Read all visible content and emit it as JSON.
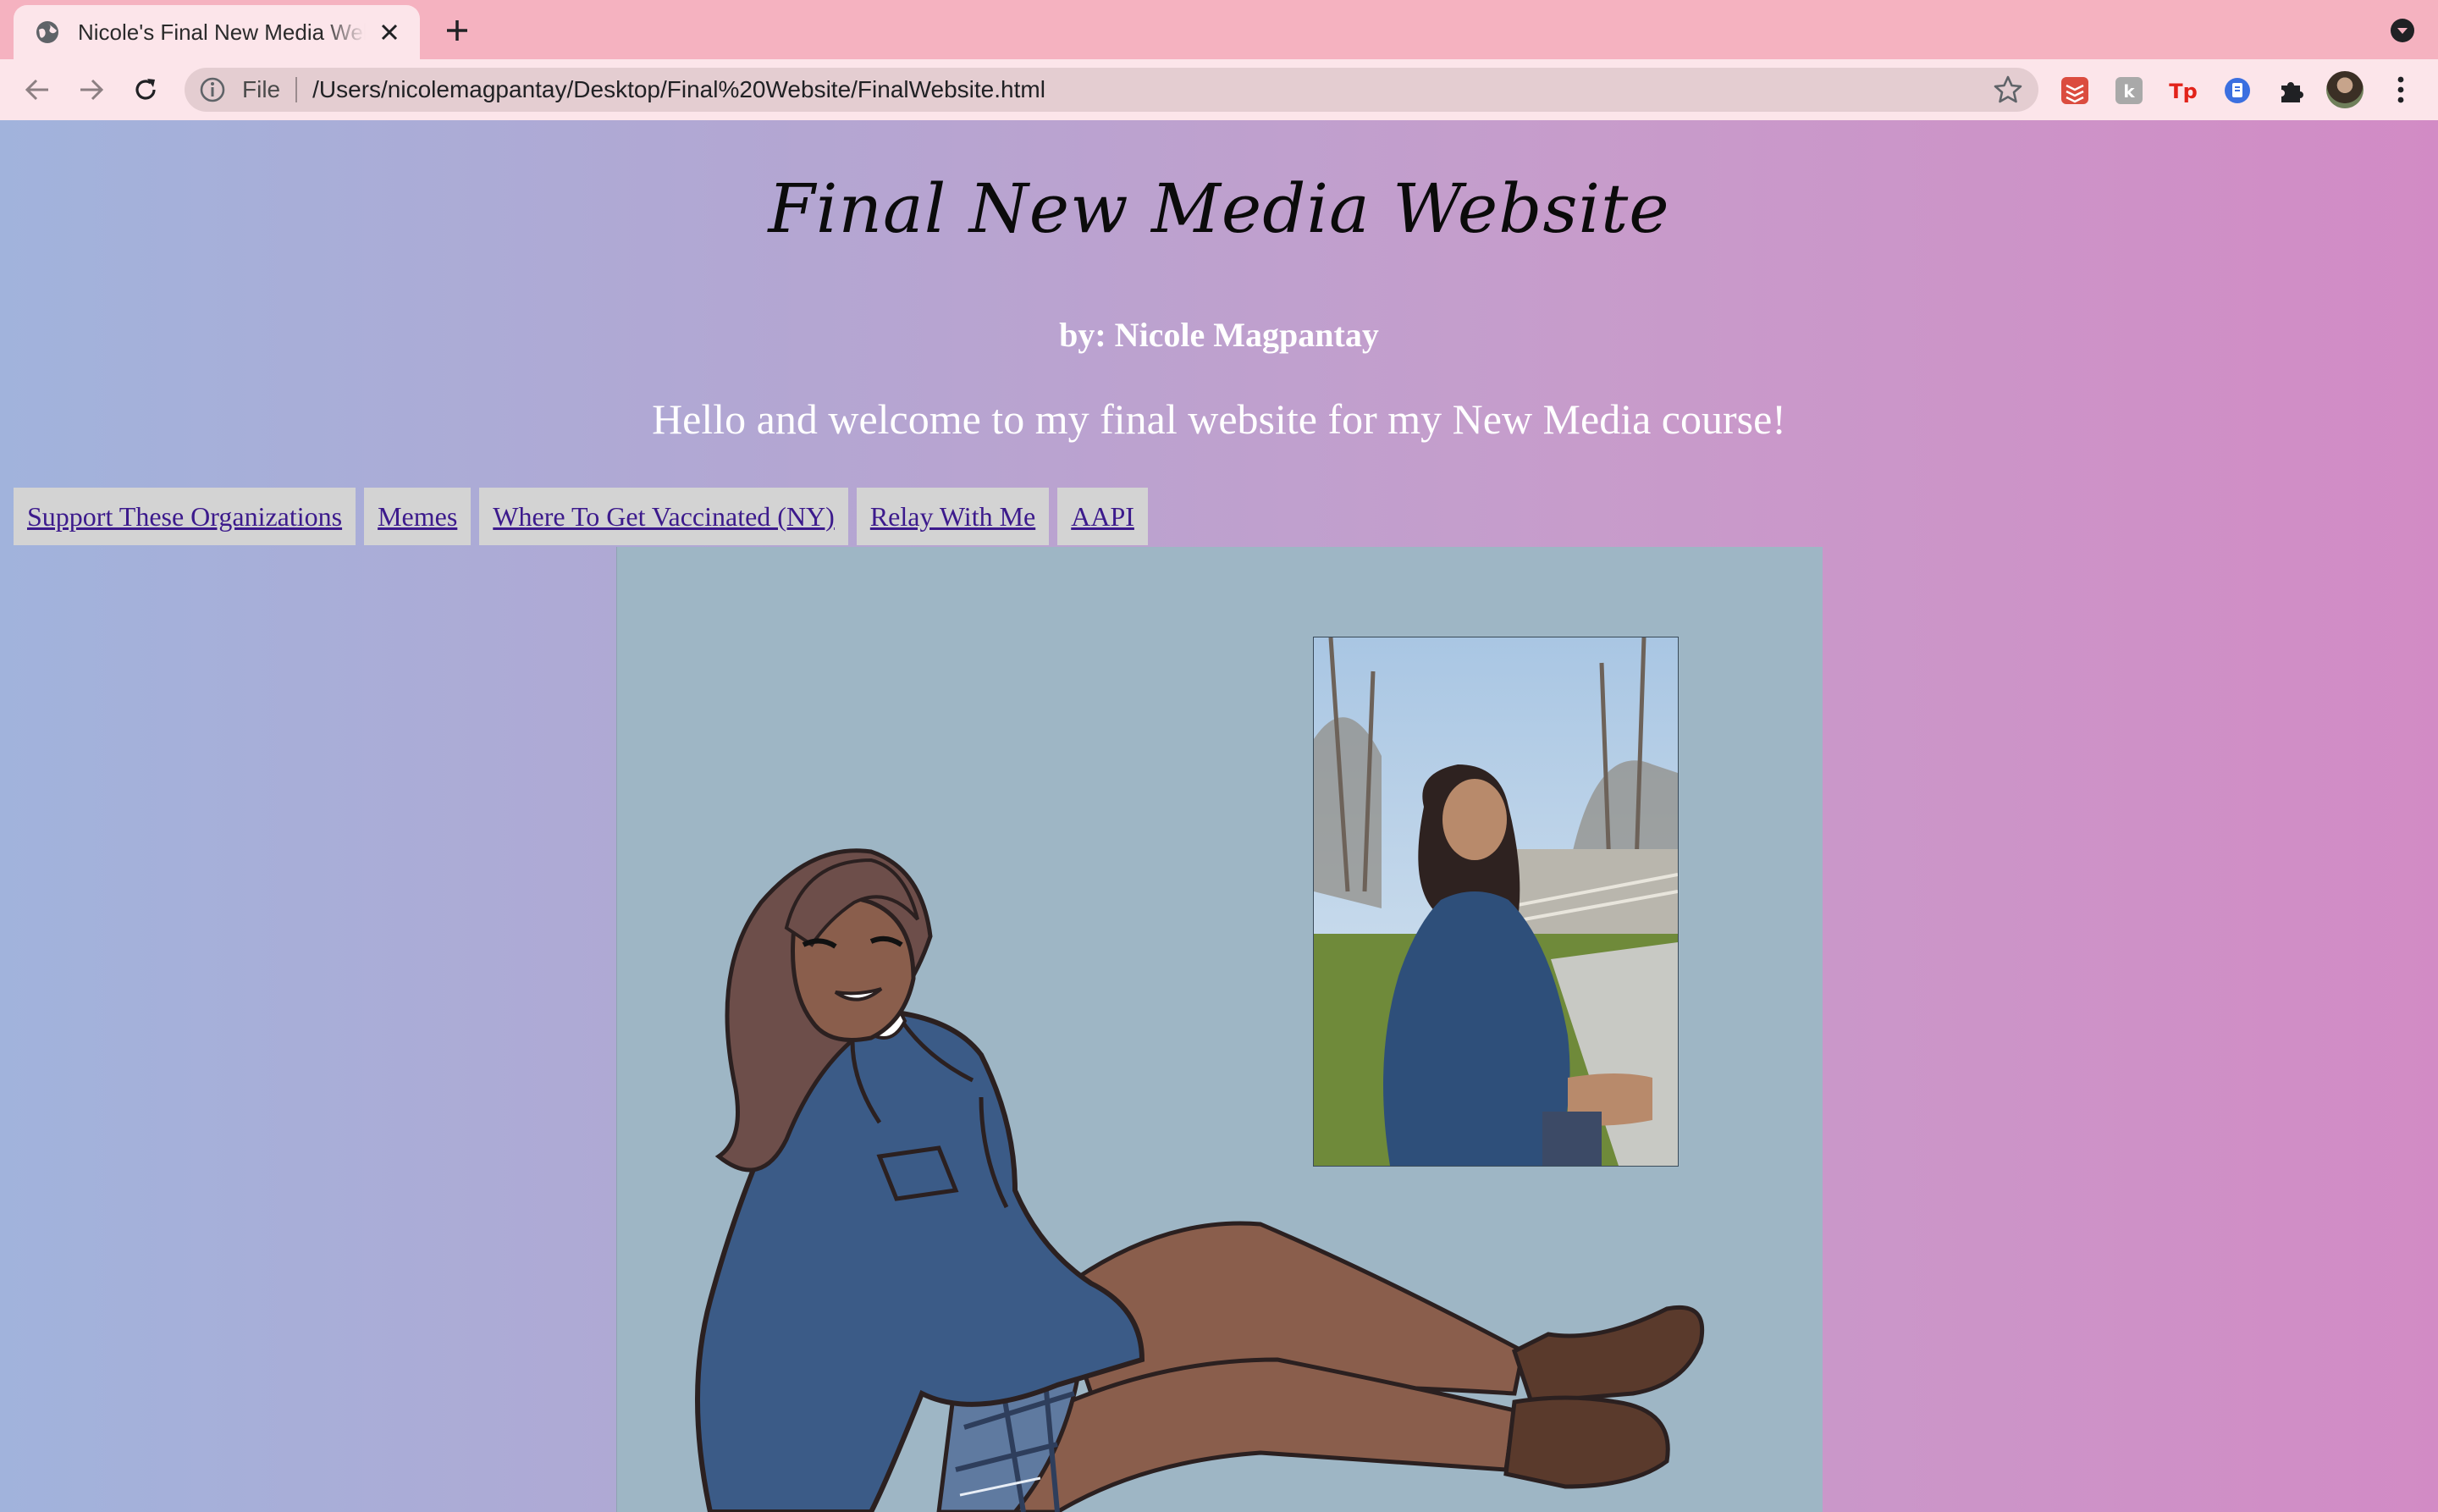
{
  "browser": {
    "tab": {
      "title": "Nicole's Final New Media Website"
    },
    "address_bar": {
      "scheme": "File",
      "url": "/Users/nicolemagpantay/Desktop/Final%20Website/FinalWebsite.html"
    },
    "extensions": [
      "todoist-icon",
      "k-extension-icon",
      "tp-extension-icon",
      "blue-extension-icon",
      "puzzle-icon"
    ],
    "colors": {
      "tabstrip": "#f5b2c0",
      "toolbar": "#fce5ea"
    }
  },
  "page": {
    "title": "Final New Media Website",
    "byline": "by: Nicole Magpantay",
    "welcome": "Hello and welcome to my final website for my New Media course!",
    "nav": [
      {
        "label": "Support These Organizations"
      },
      {
        "label": "Memes"
      },
      {
        "label": "Where To Get Vaccinated (NY)"
      },
      {
        "label": "Relay With Me"
      },
      {
        "label": "AAPI"
      }
    ],
    "colors": {
      "gradient_start": "#a1b3dc",
      "gradient_end": "#d28bc5",
      "link": "#3c1a8c",
      "nav_bg": "#d3d3d3",
      "hero_bg": "#9eb6c5"
    }
  }
}
